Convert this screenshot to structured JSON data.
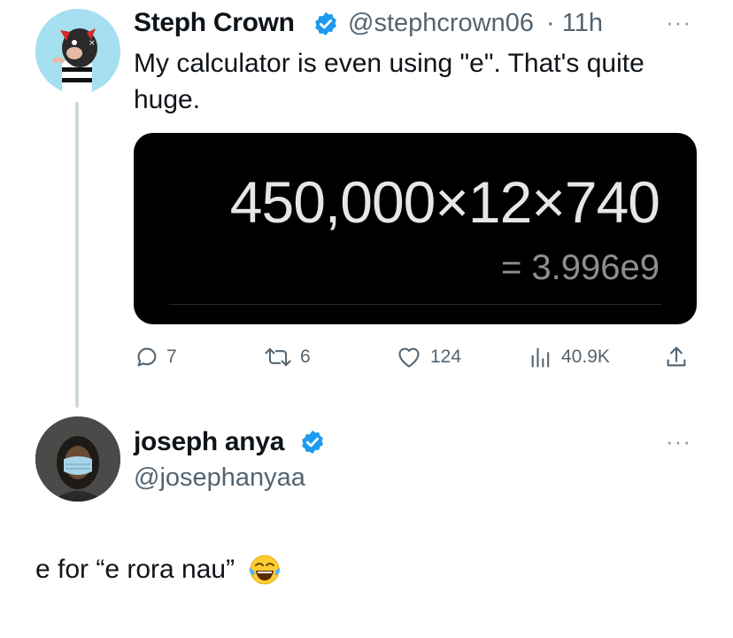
{
  "tweet": {
    "author_name": "Steph Crown",
    "author_handle": "@stephcrown06",
    "time": "· 11h",
    "text_line1": "My calculator is even using \"e\". That's quite",
    "text_line2": "huge.",
    "more_label": "···",
    "calculator": {
      "expression": "450,000×12×740",
      "result": "= 3.996e9"
    },
    "actions": {
      "replies": "7",
      "retweets": "6",
      "likes": "124",
      "views": "40.9K"
    }
  },
  "reply": {
    "author_name": "joseph anya",
    "author_handle": "@josephanyaa",
    "more_label": "···",
    "text": "e for “e rora nau”"
  },
  "colors": {
    "verified": "#1d9bf0",
    "muted": "#536471",
    "thread_line": "#cfd9de"
  }
}
